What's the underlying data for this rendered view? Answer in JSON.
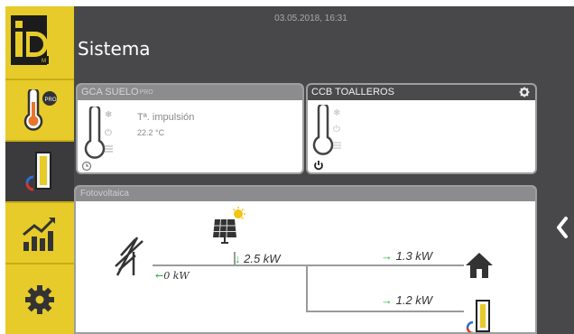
{
  "header": {
    "datetime": "03.05.2018, 16:31",
    "title": "Sistema"
  },
  "cards": [
    {
      "title": "GCA SUELO",
      "badge": "PRO",
      "label": "Tª. impulsión",
      "value": "22.2 °C"
    },
    {
      "title": "CCB TOALLEROS"
    }
  ],
  "photovoltaic": {
    "title": "Fotovoltaica",
    "solar_power": "2.5 kW",
    "grid_power": "0 kW",
    "house_power": "1.3 kW",
    "towel_power": "1.2 kW"
  },
  "colors": {
    "sidebar": "#e6cb2a",
    "main_bg": "#48484b",
    "accent_green": "#2db34a",
    "card_border": "#9e9e9e"
  },
  "icons": {
    "logo": "id-logo",
    "sidebar": [
      "thermometer-pro-icon",
      "door-heat-icon",
      "chart-bars-icon",
      "gear-icon"
    ],
    "back": "chevron-left-icon"
  }
}
